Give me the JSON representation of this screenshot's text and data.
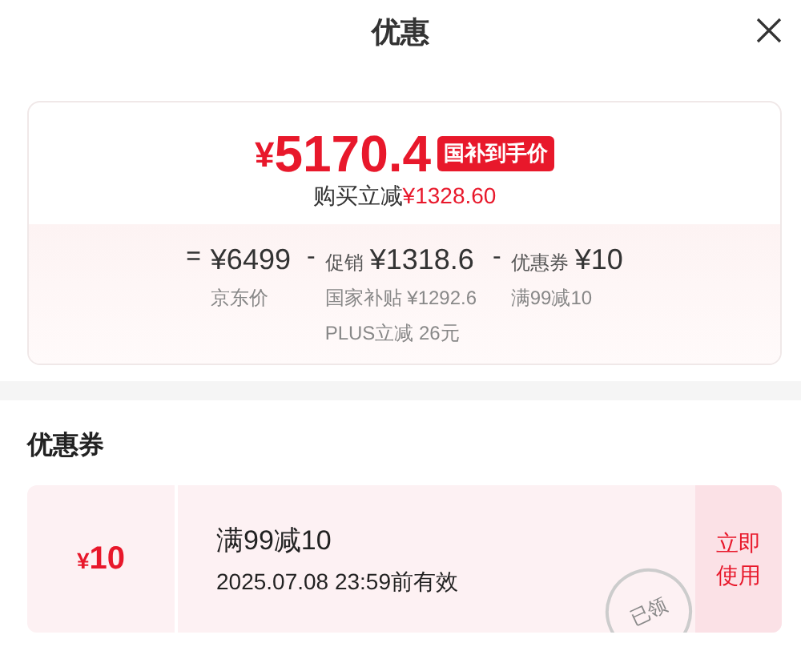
{
  "header": {
    "title": "优惠"
  },
  "price": {
    "currency": "¥",
    "amount": "5170.4",
    "tag": "国补到手价",
    "saving_label": "购买立减",
    "saving_amount": "¥1328.60"
  },
  "breakdown": [
    {
      "sign": "=",
      "amount": "¥6499",
      "notes": [
        "京东价"
      ]
    },
    {
      "sign": "-",
      "label": "促销",
      "amount": "¥1318.6",
      "notes": [
        "国家补贴 ¥1292.6",
        "PLUS立减 26元"
      ]
    },
    {
      "sign": "-",
      "label": "优惠券",
      "amount": "¥10",
      "notes": [
        "满99减10"
      ]
    }
  ],
  "coupons_section": {
    "title": "优惠券",
    "coupons": [
      {
        "currency": "¥",
        "value": "10",
        "name": "满99减10",
        "validity": "2025.07.08 23:59前有效",
        "action": "立即使用",
        "claimed": true,
        "stamp": "已领"
      }
    ]
  }
}
